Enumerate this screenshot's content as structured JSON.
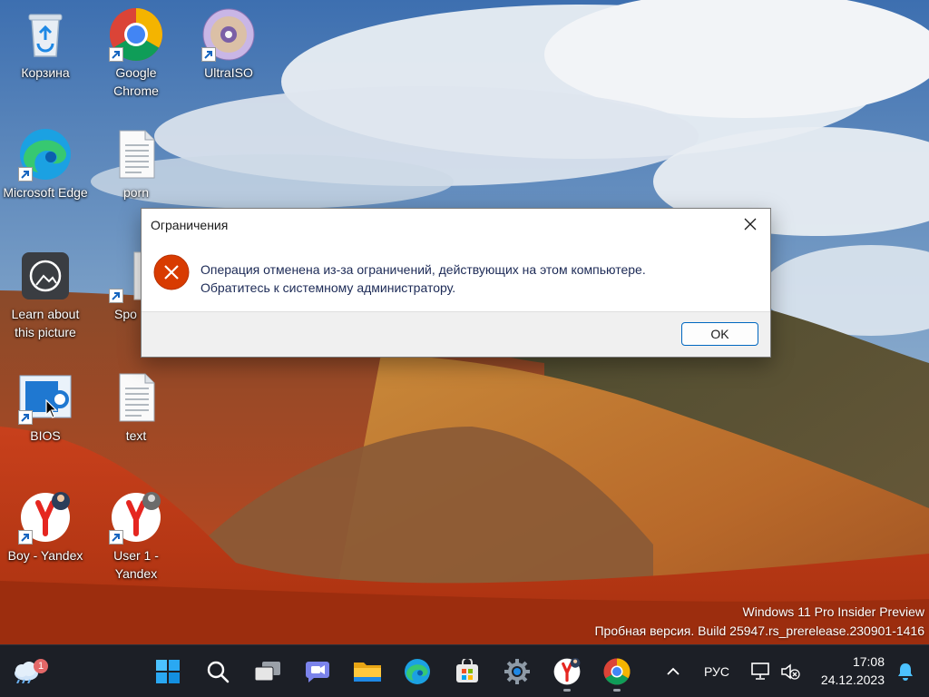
{
  "desktop": {
    "icons": [
      {
        "label": "Корзина"
      },
      {
        "label": "Google Chrome"
      },
      {
        "label": "UltraISO"
      },
      {
        "label": "Microsoft Edge"
      },
      {
        "label": "porn"
      },
      {
        "label": "Learn about this picture"
      },
      {
        "label": "Spo"
      },
      {
        "label": "BIOS"
      },
      {
        "label": "text"
      },
      {
        "label": "Boy - Yandex"
      },
      {
        "label": "User 1 - Yandex"
      }
    ]
  },
  "dialog": {
    "title": "Ограничения",
    "message_line1": "Операция отменена из-за ограничений, действующих на этом компьютере.",
    "message_line2": "Обратитесь к системному администратору.",
    "ok_label": "OK",
    "icon": "error-icon"
  },
  "watermark": {
    "line1": "Windows 11 Pro Insider Preview",
    "line2": "Пробная версия. Build 25947.rs_prerelease.230901-1416"
  },
  "taskbar": {
    "weather_badge": "1",
    "apps": [
      "start-icon",
      "search-icon",
      "task-view-icon",
      "chat-icon",
      "file-explorer-icon",
      "edge-icon",
      "store-icon",
      "settings-icon",
      "yandex-icon",
      "chrome-icon"
    ],
    "tray": {
      "language": "РУС",
      "time": "17:08",
      "date": "24.12.2023"
    }
  },
  "colors": {
    "taskbar_bg": "#1c1f26",
    "error_red": "#d83b01",
    "accent": "#0067c0"
  }
}
